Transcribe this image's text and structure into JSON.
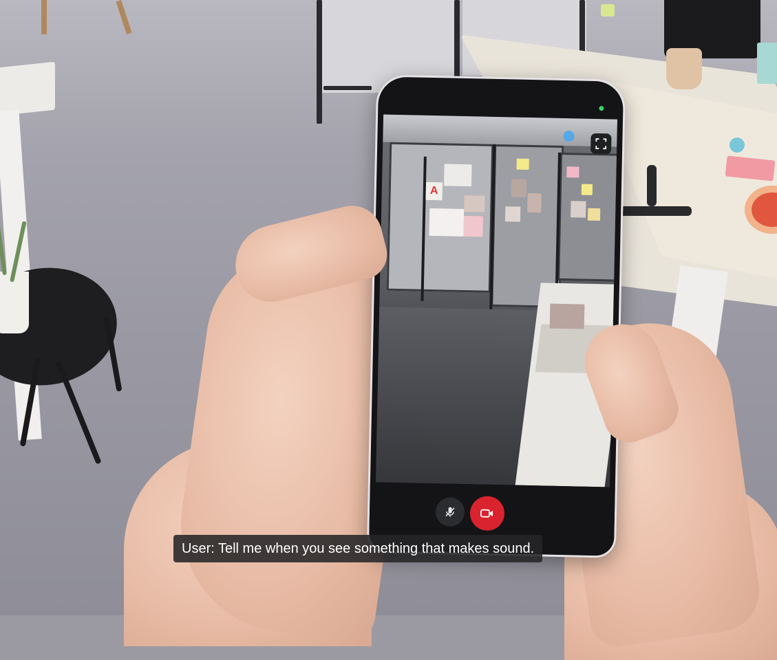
{
  "subtitle": {
    "speaker": "User",
    "text": "User: Tell me when you see something that makes sound."
  },
  "phone_app": {
    "viewfinder_sign": "A",
    "icons": {
      "expand": "fullscreen-expand-icon",
      "mute": "mic-off-icon",
      "record": "video-camera-icon"
    },
    "colors": {
      "record_button": "#d9232e",
      "status_dot": "#39d36b"
    }
  }
}
